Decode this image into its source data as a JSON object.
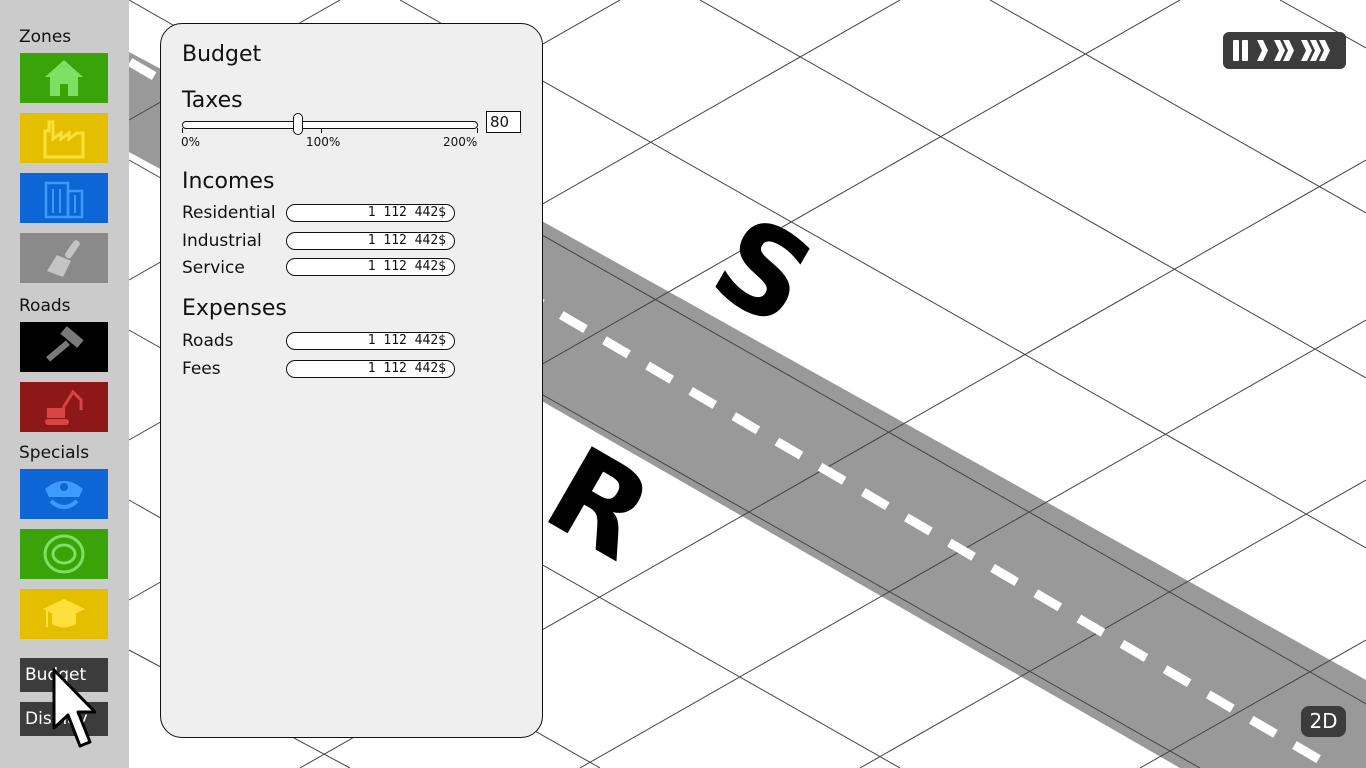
{
  "sidebar": {
    "zones_label": "Zones",
    "roads_label": "Roads",
    "specials_label": "Specials",
    "zone_tools": [
      {
        "name": "residential",
        "icon": "house-icon",
        "color": "#3aa30a"
      },
      {
        "name": "industrial",
        "icon": "factory-icon",
        "color": "#e3bf00"
      },
      {
        "name": "service",
        "icon": "office-building-icon",
        "color": "#0e66d6"
      },
      {
        "name": "dezone",
        "icon": "brush-icon",
        "color": "#8a8a8a"
      }
    ],
    "road_tools": [
      {
        "name": "build-road",
        "icon": "hammer-icon",
        "color": "#000000"
      },
      {
        "name": "demolish",
        "icon": "excavator-icon",
        "color": "#8e1818"
      }
    ],
    "special_tools": [
      {
        "name": "police",
        "icon": "police-cap-icon",
        "color": "#0e66d6"
      },
      {
        "name": "stadium",
        "icon": "stadium-icon",
        "color": "#3aa30a"
      },
      {
        "name": "school",
        "icon": "graduation-cap-icon",
        "color": "#e3bf00"
      }
    ],
    "budget_button": "Budget",
    "display_button": "Display"
  },
  "budget": {
    "title": "Budget",
    "taxes_label": "Taxes",
    "tax_min_label": "0%",
    "tax_mid_label": "100%",
    "tax_max_label": "200%",
    "tax_value": "80",
    "incomes_label": "Incomes",
    "incomes": [
      {
        "label": "Residential",
        "value": "1 112 442$"
      },
      {
        "label": "Industrial",
        "value": "1 112 442$"
      },
      {
        "label": "Service",
        "value": "1 112 442$"
      }
    ],
    "expenses_label": "Expenses",
    "expenses": [
      {
        "label": "Roads",
        "value": "1 112 442$"
      },
      {
        "label": "Fees",
        "value": "1 112 442$"
      }
    ]
  },
  "map": {
    "zone_letter_service": "S",
    "zone_letter_residential": "R"
  },
  "hud": {
    "view_toggle": "2D",
    "speed_icon": "speed-control-icon"
  }
}
